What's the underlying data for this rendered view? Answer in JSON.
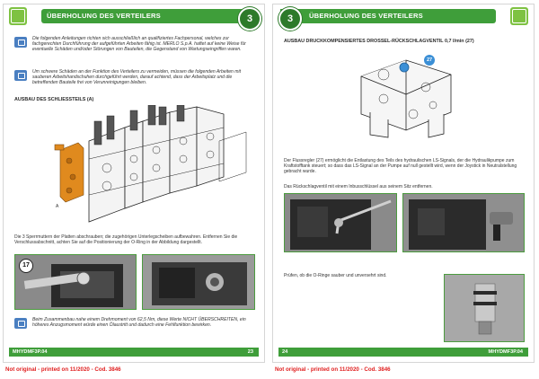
{
  "left_page": {
    "chapter_title": "ÜBERHOLUNG DES VERTEILERS",
    "chapter_number": "3",
    "notes": [
      "Die folgenden Anleitungen richten sich ausschließlich an qualifiziertes Fachpersonal, welches zur fachgerechten Durchführung der aufgeführten Arbeiten fähig ist. MERLO S.p.A. haftet auf keine Weise für eventuelle Schäden und/oder Störungen von Bauteilen, die Gegenstand von Wartungseingriffen waren.",
      "Um schwere Schäden an der Funktion des Verteilers zu vermeiden, müssen die folgenden Arbeiten mit sauberen Arbeitshandschuhen durchgeführt werden, darauf achtend, dass der Arbeitsplatz und die betreffenden Bauteile frei von Verunreinigungen bleiben."
    ],
    "section_title": "AUSBAU DES SCHLIESSTEILS (A)",
    "diagram_label": "A",
    "body_text": "Die 3 Sperrmuttern der Platten abschrauben; die zugehörigen Unterlegscheiben aufbewahren. Entfernen Sie die Verschlussabschnitt, achten Sie auf die Positionierung der O-Ring in der Abbildung dargestellt.",
    "step_number": "17",
    "bottom_note": "Beim Zusammenbau nahe einem Drehmoment von 62,5 Nm, diese Werte NICHT ÜBERSCHREITEN, ein höheres Anzugsmoment würde einen Ölaustritt und dadurch eine Fehlfunktion bewirken.",
    "footer_code": "MHYDMF3P.04",
    "page_number": "23",
    "disclaimer": "Not original - printed on 11/2020 - Cod. 3846"
  },
  "right_page": {
    "chapter_title": "ÜBERHOLUNG DES VERTEILERS",
    "chapter_number": "3",
    "section_title": "AUSBAU DRUCKKOMPENSIERTES DROSSEL-RÜCKSCHLAGVENTIL 0,7 l/min (27)",
    "callout_number": "27",
    "body_text_1": "Der Flussregler (27) ermöglicht die Entlastung des Teils des hydraulischen LS-Signals, der die Hydraulikpumpe zum Kraftstofftank steuert; so dass das LS-Signal an der Pumpe auf null gestellt wird, wenn der Joystick in Neutralstellung gebracht wurde.",
    "body_text_2": "Das Rückschlagventil mit einem Inbusschlüssel aus seinem Sitz entfernen.",
    "body_text_3": "Prüfen, ob die O-Ringe sauber und unversehrt sind.",
    "footer_code": "MHYDMF3P.04",
    "page_number": "24",
    "disclaimer": "Not original - printed on 11/2020 - Cod. 3846"
  },
  "colors": {
    "header_green": "#3f9e3a",
    "badge_green": "#2d7a2a",
    "note_icon_blue": "#4a7fc1",
    "disclaimer_red": "#e02020",
    "highlight_orange": "#e08a1e"
  }
}
